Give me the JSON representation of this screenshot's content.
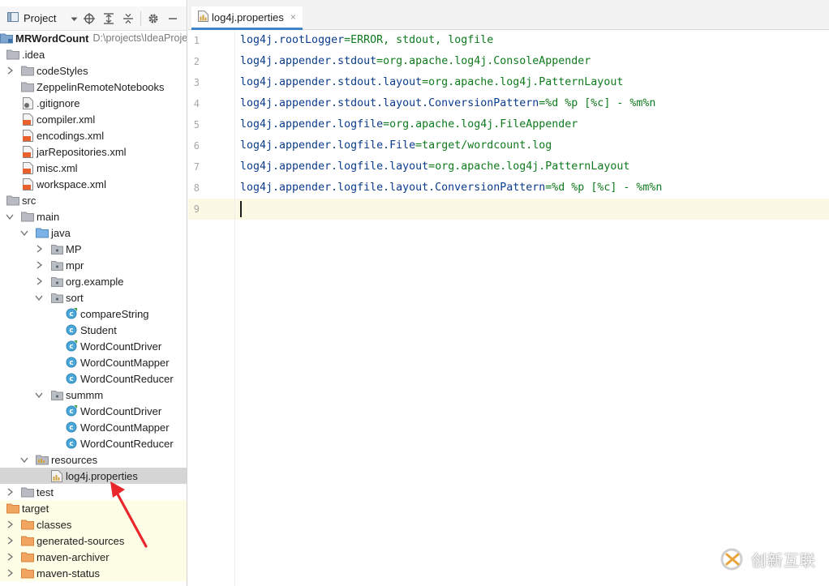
{
  "project_toolbar": {
    "title": "Project"
  },
  "editor": {
    "tab_label": "log4j.properties",
    "tab_close": "×",
    "lines": [
      {
        "num": "1",
        "key": "log4j.rootLogger",
        "eq": "=",
        "val": "ERROR, stdout, logfile"
      },
      {
        "num": "2",
        "key": "log4j.appender.stdout",
        "eq": "=",
        "val": "org.apache.log4j.ConsoleAppender"
      },
      {
        "num": "3",
        "key": "log4j.appender.stdout.layout",
        "eq": "=",
        "val": "org.apache.log4j.PatternLayout"
      },
      {
        "num": "4",
        "key": "log4j.appender.stdout.layout.ConversionPattern",
        "eq": "=",
        "val": "%d %p [%c] - %m%n"
      },
      {
        "num": "5",
        "key": "log4j.appender.logfile",
        "eq": "=",
        "val": "org.apache.log4j.FileAppender"
      },
      {
        "num": "6",
        "key": "log4j.appender.logfile.File",
        "eq": "=",
        "val": "target/wordcount.log"
      },
      {
        "num": "7",
        "key": "log4j.appender.logfile.layout",
        "eq": "=",
        "val": "org.apache.log4j.PatternLayout"
      },
      {
        "num": "8",
        "key": "log4j.appender.logfile.layout.ConversionPattern",
        "eq": "=",
        "val": "%d %p [%c] - %m%n"
      },
      {
        "num": "9",
        "key": "",
        "eq": "",
        "val": ""
      }
    ]
  },
  "tree": {
    "root": {
      "label": "MRWordCount",
      "path": "D:\\projects\\IdeaProje"
    },
    "idea": ".idea",
    "codeStyles": "codeStyles",
    "zeppelin": "ZeppelinRemoteNotebooks",
    "gitignore": ".gitignore",
    "compiler": "compiler.xml",
    "encodings": "encodings.xml",
    "jarRepositories": "jarRepositories.xml",
    "misc": "misc.xml",
    "workspace": "workspace.xml",
    "src": "src",
    "main": "main",
    "java": "java",
    "MP": "MP",
    "mpr": "mpr",
    "orgExample": "org.example",
    "sort": "sort",
    "compareString": "compareString",
    "student": "Student",
    "wcDriver1": "WordCountDriver",
    "wcMapper1": "WordCountMapper",
    "wcReducer1": "WordCountReducer",
    "summm": "summm",
    "wcDriver2": "WordCountDriver",
    "wcMapper2": "WordCountMapper",
    "wcReducer2": "WordCountReducer",
    "resources": "resources",
    "log4j": "log4j.properties",
    "test": "test",
    "target": "target",
    "classes": "classes",
    "generatedSources": "generated-sources",
    "mavenArchiver": "maven-archiver",
    "mavenStatus": "maven-status"
  },
  "watermark": {
    "text": "创新互联"
  },
  "colors": {
    "selection": "#d5d5d5",
    "tab_underline": "#4083c9",
    "annotation": "#e8262b",
    "target_tint": "#fefde6"
  }
}
